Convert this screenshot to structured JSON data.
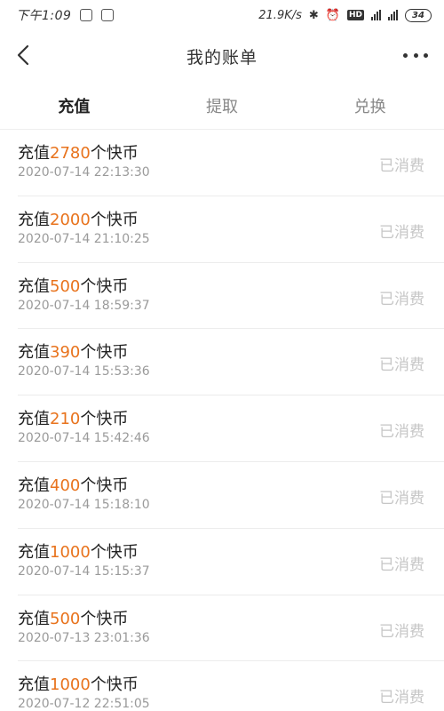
{
  "status_bar": {
    "time": "下午1:09",
    "net_speed": "21.9K/s",
    "battery": "34"
  },
  "header": {
    "title": "我的账单"
  },
  "tabs": [
    {
      "label": "充值",
      "active": true
    },
    {
      "label": "提取",
      "active": false
    },
    {
      "label": "兑换",
      "active": false
    }
  ],
  "records": [
    {
      "prefix": "充值",
      "amount": "2780",
      "suffix": "个快币",
      "date": "2020-07-14 22:13:30",
      "status": "已消费"
    },
    {
      "prefix": "充值",
      "amount": "2000",
      "suffix": "个快币",
      "date": "2020-07-14 21:10:25",
      "status": "已消费"
    },
    {
      "prefix": "充值",
      "amount": "500",
      "suffix": "个快币",
      "date": "2020-07-14 18:59:37",
      "status": "已消费"
    },
    {
      "prefix": "充值",
      "amount": "390",
      "suffix": "个快币",
      "date": "2020-07-14 15:53:36",
      "status": "已消费"
    },
    {
      "prefix": "充值",
      "amount": "210",
      "suffix": "个快币",
      "date": "2020-07-14 15:42:46",
      "status": "已消费"
    },
    {
      "prefix": "充值",
      "amount": "400",
      "suffix": "个快币",
      "date": "2020-07-14 15:18:10",
      "status": "已消费"
    },
    {
      "prefix": "充值",
      "amount": "1000",
      "suffix": "个快币",
      "date": "2020-07-14 15:15:37",
      "status": "已消费"
    },
    {
      "prefix": "充值",
      "amount": "500",
      "suffix": "个快币",
      "date": "2020-07-13 23:01:36",
      "status": "已消费"
    },
    {
      "prefix": "充值",
      "amount": "1000",
      "suffix": "个快币",
      "date": "2020-07-12 22:51:05",
      "status": "已消费"
    }
  ],
  "colors": {
    "accent": "#e8731d",
    "status_text": "#c6c6c6"
  },
  "icons": {
    "back": "chevron-left-icon",
    "more": "more-dots-icon"
  }
}
